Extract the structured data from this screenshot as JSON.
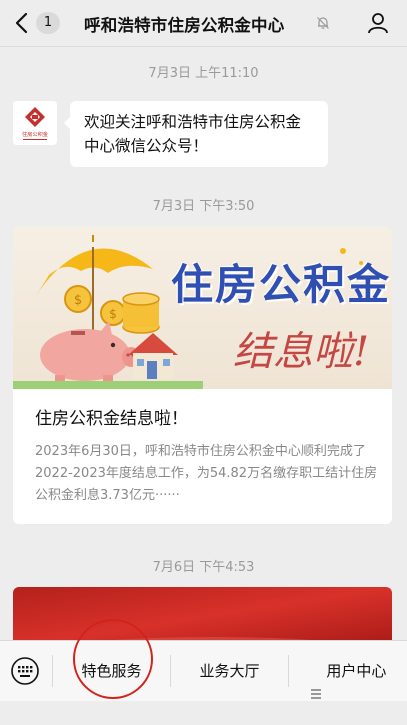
{
  "header": {
    "unread_count": "1",
    "title": "呼和浩特市住房公积金中心"
  },
  "messages": [
    {
      "timestamp": "7月3日 上午11:10",
      "text": "欢迎关注呼和浩特市住房公积金中心微信公众号！",
      "avatar_label": "住房公积金"
    }
  ],
  "articles": [
    {
      "timestamp": "7月3日 下午3:50",
      "image_title": "住房公积金",
      "image_subtitle": "结息啦!",
      "title": "住房公积金结息啦！",
      "description": "2023年6月30日，呼和浩特市住房公积金中心顺利完成了2022-2023年度结息工作，为54.82万名缴存职工结计住房公积金利息3.73亿元······"
    },
    {
      "timestamp": "7月6日 下午4:53"
    }
  ],
  "menu": {
    "items": [
      {
        "label": "特色服务"
      },
      {
        "label": "业务大厅"
      },
      {
        "label": "用户中心"
      }
    ]
  },
  "colors": {
    "background": "#ededed",
    "accent_red": "#d1231c",
    "brand_blue": "#2f4fb3"
  }
}
